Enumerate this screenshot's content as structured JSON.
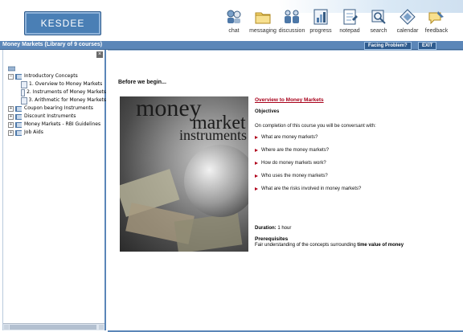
{
  "header": {
    "logo_text": "KESDEE",
    "tools": [
      {
        "label": "chat",
        "icon": "chat-icon"
      },
      {
        "label": "messaging",
        "icon": "folder-icon"
      },
      {
        "label": "discussion",
        "icon": "people-icon"
      },
      {
        "label": "progress",
        "icon": "progress-icon"
      },
      {
        "label": "notepad",
        "icon": "notepad-icon"
      },
      {
        "label": "search",
        "icon": "search-icon"
      },
      {
        "label": "calendar",
        "icon": "calendar-icon"
      },
      {
        "label": "feedback",
        "icon": "feedback-icon"
      }
    ]
  },
  "titlebar": {
    "title": "Money Markets (Library of 9 courses)",
    "facing_problem": "Facing Problem?",
    "exit": "EXIT"
  },
  "tree": {
    "items": [
      {
        "label": "Introductory Concepts",
        "expanded": true
      },
      {
        "label": "1. Overview to Money Markets",
        "child": true
      },
      {
        "label": "2. Instruments of Money Markets",
        "child": true
      },
      {
        "label": "3. Arithmetic for Money Markets",
        "child": true
      },
      {
        "label": "Coupon bearing Instruments"
      },
      {
        "label": "Discount Instruments"
      },
      {
        "label": "Money Markets - RBI Guidelines"
      },
      {
        "label": "Job Aids"
      }
    ]
  },
  "content": {
    "heading": "Before we begin...",
    "photo_text": {
      "w1": "money",
      "w2": "market",
      "w3": "instruments"
    },
    "course_link": "Overview to Money Markets",
    "objectives_label": "Objectives",
    "intro": "On completion of this course you will be conversant with:",
    "bullets": [
      "What are money markets?",
      "Where are the money markets?",
      "How do money markets work?",
      "Who uses the money markets?",
      "What are the risks involved in money markets?"
    ],
    "duration_label": "Duration:",
    "duration_value": "1 hour",
    "prereq_label": "Prerequisites",
    "prereq_text": "Fair understanding of the concepts surrounding",
    "prereq_bold": "time value of money"
  },
  "colors": {
    "titlebar": "#5b86b8",
    "link": "#a8001a",
    "bullet": "#b0001a"
  }
}
